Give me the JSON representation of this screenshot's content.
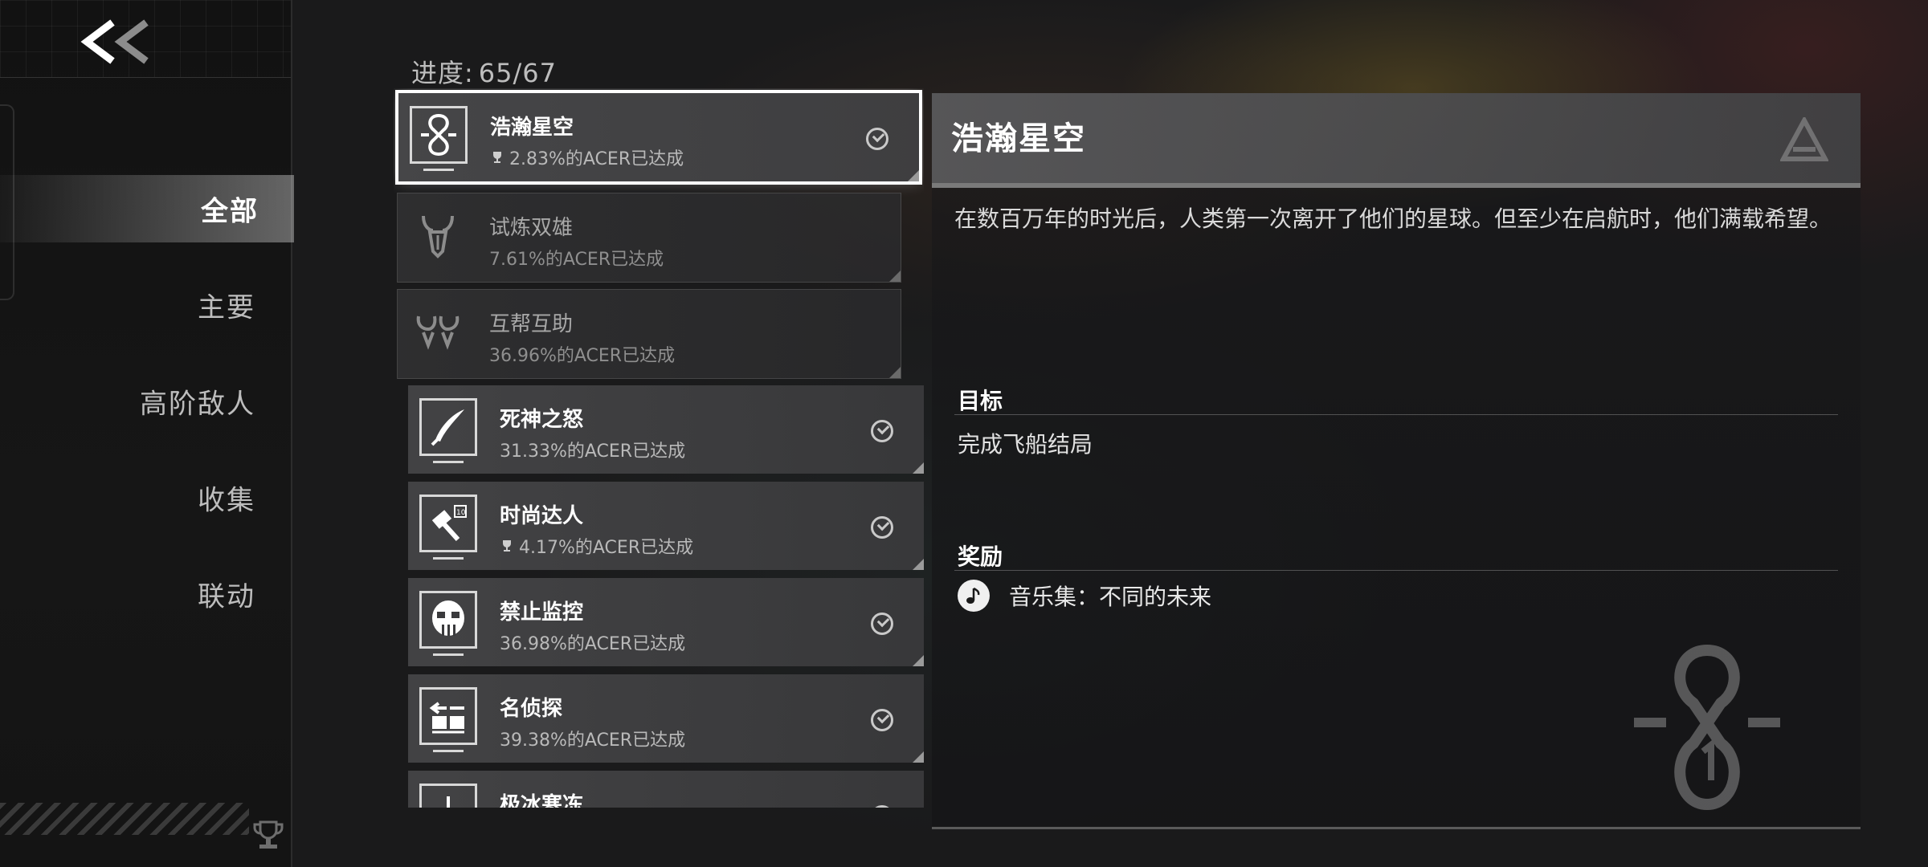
{
  "progress": {
    "label": "进度:",
    "value": "65/67"
  },
  "sidebar": {
    "back_label": "<<",
    "items": [
      {
        "label": "全部",
        "active": true
      },
      {
        "label": "主要",
        "active": false
      },
      {
        "label": "高阶敌人",
        "active": false
      },
      {
        "label": "收集",
        "active": false
      },
      {
        "label": "联动",
        "active": false
      }
    ]
  },
  "achievements": [
    {
      "title": "浩瀚星空",
      "pct": "2.83%的ACER已达成",
      "rare": true,
      "completed": true,
      "icon": "infinity-emblem-icon"
    },
    {
      "title": "试炼双雄",
      "pct": "7.61%的ACER已达成",
      "rare": false,
      "completed": false,
      "icon": "horned-helmet-icon"
    },
    {
      "title": "互帮互助",
      "pct": "36.96%的ACER已达成",
      "rare": false,
      "completed": false,
      "icon": "twin-horns-icon"
    },
    {
      "title": "死神之怒",
      "pct": "31.33%的ACER已达成",
      "rare": false,
      "completed": true,
      "icon": "blade-icon"
    },
    {
      "title": "时尚达人",
      "pct": "4.17%的ACER已达成",
      "rare": true,
      "completed": true,
      "icon": "hammer-10-icon"
    },
    {
      "title": "禁止监控",
      "pct": "36.98%的ACER已达成",
      "rare": false,
      "completed": true,
      "icon": "robot-head-icon"
    },
    {
      "title": "名侦探",
      "pct": "39.38%的ACER已达成",
      "rare": false,
      "completed": true,
      "icon": "magnifier-icon"
    },
    {
      "title": "极冰寒冻",
      "pct": "",
      "rare": false,
      "completed": true,
      "icon": "ice-icon"
    }
  ],
  "detail": {
    "title": "浩瀚星空",
    "description": "在数百万年的时光后，人类第一次离开了他们的星球。但至少在启航时，他们满载希望。",
    "goal_label": "目标",
    "goal_text": "完成飞船结局",
    "reward_label": "奖励",
    "reward_text": "音乐集：不同的未来"
  }
}
